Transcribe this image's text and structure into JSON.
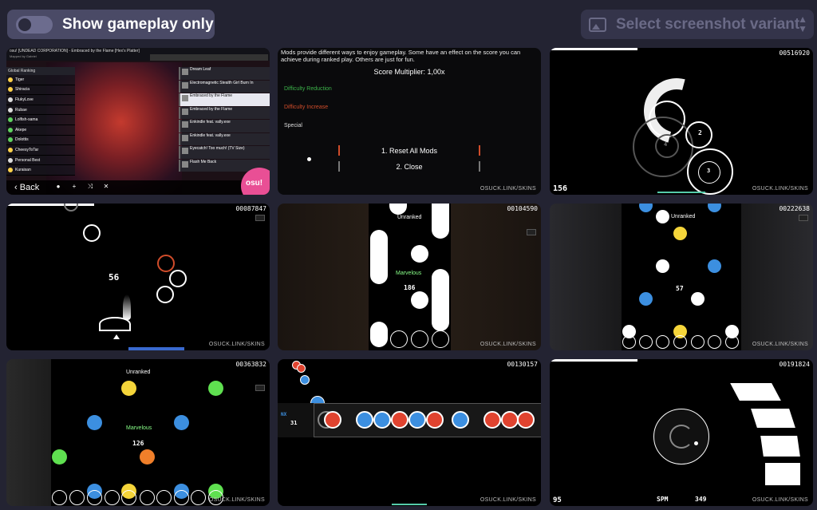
{
  "toolbar": {
    "toggle_label": "Show gameplay only",
    "variant_placeholder": "Select screenshot variant"
  },
  "watermark": "OSUCK.LINK/SKINS",
  "tiles": {
    "song_select": {
      "title": "osu! [UNDEAD CORPORATION] - Embraced by the Flame [Hex's Platter]",
      "mapper": "Mapped by Gabriel",
      "ranking_label": "Global Ranking",
      "group_label": "Group",
      "sort_label": "Sort",
      "back_label": "Back",
      "osu_label": "osu!",
      "leaderboard": [
        {
          "name": "Tiger",
          "color": "#ffd24a"
        },
        {
          "name": "Shiracia",
          "color": "#ffd24a"
        },
        {
          "name": "FlukyLove",
          "color": "#dddddd"
        },
        {
          "name": "Rubae",
          "color": "#dddddd"
        },
        {
          "name": "Lolfish-sama",
          "color": "#5fd35f"
        },
        {
          "name": "Akepe",
          "color": "#5fd35f"
        },
        {
          "name": "Dolottis",
          "color": "#5fd35f"
        },
        {
          "name": "CheesyToTar",
          "color": "#ffd24a"
        },
        {
          "name": "Personal Best",
          "color": "#dddddd"
        },
        {
          "name": "Kuraisan",
          "color": "#ffd24a"
        }
      ],
      "songs": [
        "Dream Leaf",
        "Electromagnetic Stealth Girl Burn In",
        "Embraced by the Flame",
        "Embraced by the Flame",
        "Enkindle feat. vally.exe",
        "Enkindle feat. vally.exe",
        "Eyecatch! Too much! (TV Size)",
        "Flash Me Back"
      ]
    },
    "mods": {
      "description": "Mods provide different ways to enjoy gameplay. Some have an effect on the score you can achieve during ranked play. Others are just for fun.",
      "multiplier": "Score Multiplier: 1,00x",
      "reduction": "Difficulty Reduction",
      "increase": "Difficulty Increase",
      "special": "Special",
      "reset": "1. Reset All Mods",
      "close": "2. Close",
      "reduction_color": "#3cb34a",
      "increase_color": "#d04c2a"
    },
    "std": {
      "score": "00516920",
      "combo": "156",
      "numbers": [
        "4",
        "2",
        "3"
      ]
    },
    "std2": {
      "score": "00087847",
      "combo": "56"
    },
    "mania4": {
      "score": "00104590",
      "unranked": "Unranked",
      "judge": "Marvelous",
      "combo": "186"
    },
    "mania7": {
      "score": "00222638",
      "unranked": "Unranked",
      "combo": "57"
    },
    "mania_big": {
      "score": "00363832",
      "unranked": "Unranked",
      "judge": "Marvelous",
      "combo": "126"
    },
    "taiko": {
      "score": "00130157",
      "combo": "31",
      "label": "NX"
    },
    "catch": {
      "score": "00191824",
      "combo": "95",
      "spm_label": "SPM",
      "spm": "349"
    }
  },
  "colors": {
    "blue": "#3c8fe0",
    "red": "#e0432f",
    "yellow": "#f5d53a",
    "green": "#5fe050",
    "orange": "#f07f2a"
  }
}
